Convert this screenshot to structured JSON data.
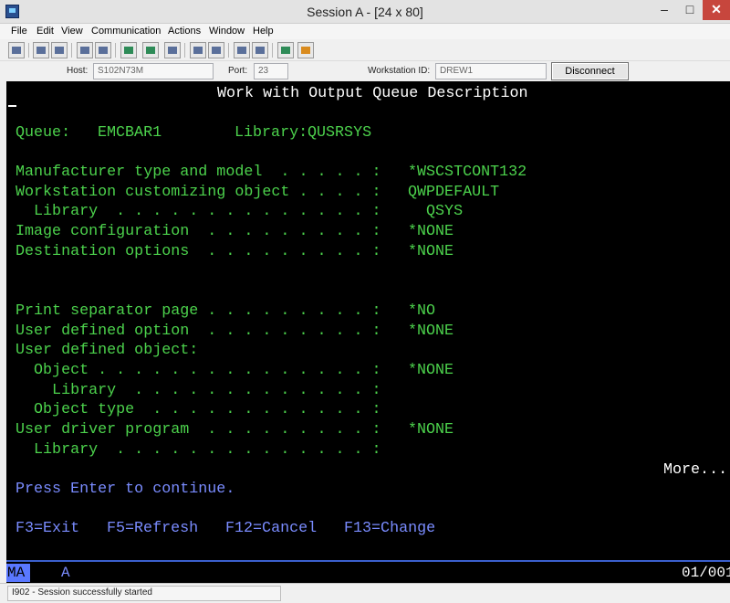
{
  "window": {
    "title": "Session A - [24 x 80]",
    "minimize": "–",
    "maximize": "□",
    "close": "✕"
  },
  "menu": {
    "items": [
      "File",
      "Edit",
      "View",
      "Communication",
      "Actions",
      "Window",
      "Help"
    ]
  },
  "toolbar": {
    "icons": [
      "print-screen-icon",
      "copy-icon",
      "paste-icon",
      "send-file-icon",
      "receive-file-icon",
      "display-icon",
      "keyboard-icon",
      "record-macro-icon",
      "play-macro-icon",
      "macro-icon",
      "connect-icon",
      "disconnect-icon",
      "help-icon"
    ]
  },
  "connection": {
    "host_label": "Host:",
    "host_value": "S102N73M",
    "port_label": "Port:",
    "port_value": "23",
    "workstation_label": "Workstation ID:",
    "workstation_value": "DREW1",
    "disconnect_label": "Disconnect"
  },
  "screen": {
    "title": "Work with Output Queue Description",
    "queue_label": "Queue:",
    "queue_value": "EMCBAR1",
    "library_label": "Library:",
    "library_value": "QUSRSYS",
    "fields": [
      {
        "label": "Manufacturer type and model  . . . . . :",
        "value": "*WSCSTCONT132"
      },
      {
        "label": "Workstation customizing object . . . . :",
        "value": "QWPDEFAULT"
      },
      {
        "label": "  Library  . . . . . . . . . . . . . . :",
        "value": "  QSYS"
      },
      {
        "label": "Image configuration  . . . . . . . . . :",
        "value": "*NONE"
      },
      {
        "label": "Destination options  . . . . . . . . . :",
        "value": "*NONE"
      },
      {
        "label": "Print separator page . . . . . . . . . :",
        "value": "*NO"
      },
      {
        "label": "User defined option  . . . . . . . . . :",
        "value": "*NONE"
      },
      {
        "label": "User defined object:",
        "value": ""
      },
      {
        "label": "  Object . . . . . . . . . . . . . . . :",
        "value": "*NONE"
      },
      {
        "label": "    Library  . . . . . . . . . . . . . :",
        "value": ""
      },
      {
        "label": "  Object type  . . . . . . . . . . . . :",
        "value": ""
      },
      {
        "label": "User driver program  . . . . . . . . . :",
        "value": "*NONE"
      },
      {
        "label": "  Library  . . . . . . . . . . . . . . :",
        "value": ""
      }
    ],
    "more": "More...",
    "instruction": "Press Enter to continue.",
    "function_keys": [
      "F3=Exit",
      "F5=Refresh",
      "F12=Cancel",
      "F13=Change"
    ]
  },
  "oia": {
    "mode": "MA",
    "indicator": "A",
    "cursor_position": "01/001"
  },
  "status": {
    "message": "I902 - Session successfully started"
  }
}
